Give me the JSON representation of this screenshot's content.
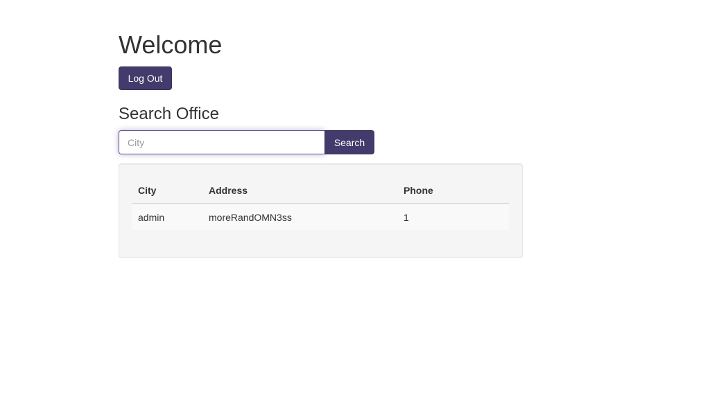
{
  "header": {
    "title": "Welcome",
    "logout_label": "Log Out"
  },
  "search": {
    "section_title": "Search Office",
    "placeholder": "City",
    "value": "",
    "button_label": "Search"
  },
  "results": {
    "columns": [
      "City",
      "Address",
      "Phone"
    ],
    "rows": [
      [
        "admin",
        "moreRandOMN3ss",
        "1"
      ]
    ]
  },
  "colors": {
    "primary": "#433b6b",
    "well_background": "#f5f5f5"
  }
}
